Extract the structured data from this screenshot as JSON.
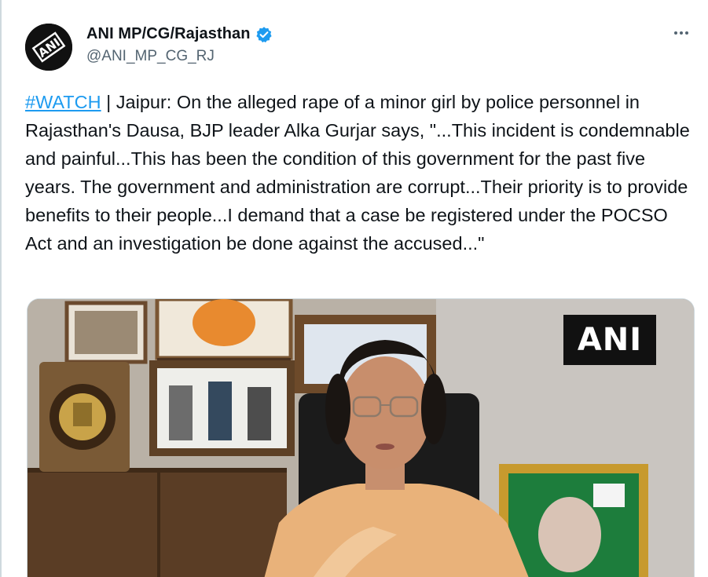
{
  "author": {
    "display_name": "ANI MP/CG/Rajasthan",
    "handle": "@ANI_MP_CG_RJ",
    "avatar_text": "ANI",
    "verified": true
  },
  "tweet": {
    "hashtag": "#WATCH",
    "body": " | Jaipur: On the alleged rape of a minor girl by police personnel in Rajasthan's Dausa, BJP leader Alka Gurjar says, \"...This incident is condemnable and painful...This has been the condition of this government for the past five years. The government and administration are corrupt...Their priority is to provide benefits to their people...I demand that a case be registered under the POCSO Act and an investigation be done against the accused...\""
  },
  "media": {
    "watermark": "ANI"
  },
  "colors": {
    "link": "#1d9bf0",
    "verified": "#1d9bf0",
    "text": "#0f1419",
    "secondary": "#536471"
  }
}
